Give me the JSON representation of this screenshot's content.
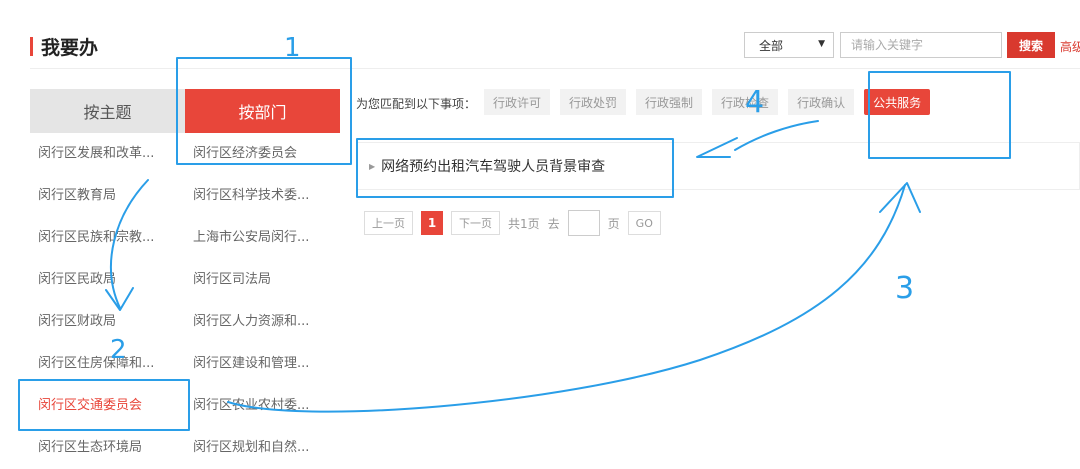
{
  "header": {
    "title": "我要办"
  },
  "search": {
    "scope": "全部",
    "placeholder": "请输入关键字",
    "button": "搜索",
    "advanced": "高级"
  },
  "tabs": {
    "theme": "按主题",
    "dept": "按部门"
  },
  "left_column": [
    "闵行区发展和改革...",
    "闵行区教育局",
    "闵行区民族和宗教...",
    "闵行区民政局",
    "闵行区财政局",
    "闵行区住房保障和...",
    "闵行区交通委员会",
    "闵行区生态环境局"
  ],
  "right_column": [
    "闵行区经济委员会",
    "闵行区科学技术委...",
    "上海市公安局闵行...",
    "闵行区司法局",
    "闵行区人力资源和...",
    "闵行区建设和管理...",
    "闵行区农业农村委...",
    "闵行区规划和自然..."
  ],
  "match_label": "为您匹配到以下事项：",
  "filters": [
    "行政许可",
    "行政处罚",
    "行政强制",
    "行政检查",
    "行政确认",
    "公共服务"
  ],
  "result": {
    "item": "网络预约出租汽车驾驶人员背景审查"
  },
  "pager": {
    "prev": "上一页",
    "current": "1",
    "next": "下一页",
    "total": "共1页",
    "goto": "去",
    "page_unit": "页",
    "go": "GO"
  },
  "annotations": {
    "n1": "1",
    "n2": "2",
    "n3": "3",
    "n4": "4",
    "color": "#2a9ee8"
  },
  "colors": {
    "accent": "#e8463a"
  }
}
